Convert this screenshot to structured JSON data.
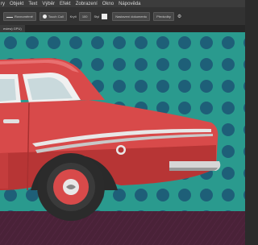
{
  "menu": {
    "items": [
      {
        "label": "ry"
      },
      {
        "label": "Objekt"
      },
      {
        "label": "Text"
      },
      {
        "label": "Výběr"
      },
      {
        "label": "Efekt"
      },
      {
        "label": "Zobrazení"
      },
      {
        "label": "Okno"
      },
      {
        "label": "Nápověda"
      }
    ]
  },
  "control_bar": {
    "stroke_style": "Rovnoměrně",
    "brush_name": "Touch Call",
    "opacity_label": "Krytí",
    "opacity_value": "100",
    "style_label": "Styl",
    "doc_setup_button": "Nastavení dokumentu",
    "preferences_button": "Předvolby",
    "fill_color": "#111111",
    "stroke_color": "#ffffff"
  },
  "document_tab": {
    "label": "eview) GPU)"
  },
  "artwork": {
    "description_icon": "illustrated-red-car",
    "background_color": "#2a9a8e",
    "dot_color": "#1e5f78",
    "car_color": "#d84a4a",
    "ground_color": "#4a2238"
  }
}
